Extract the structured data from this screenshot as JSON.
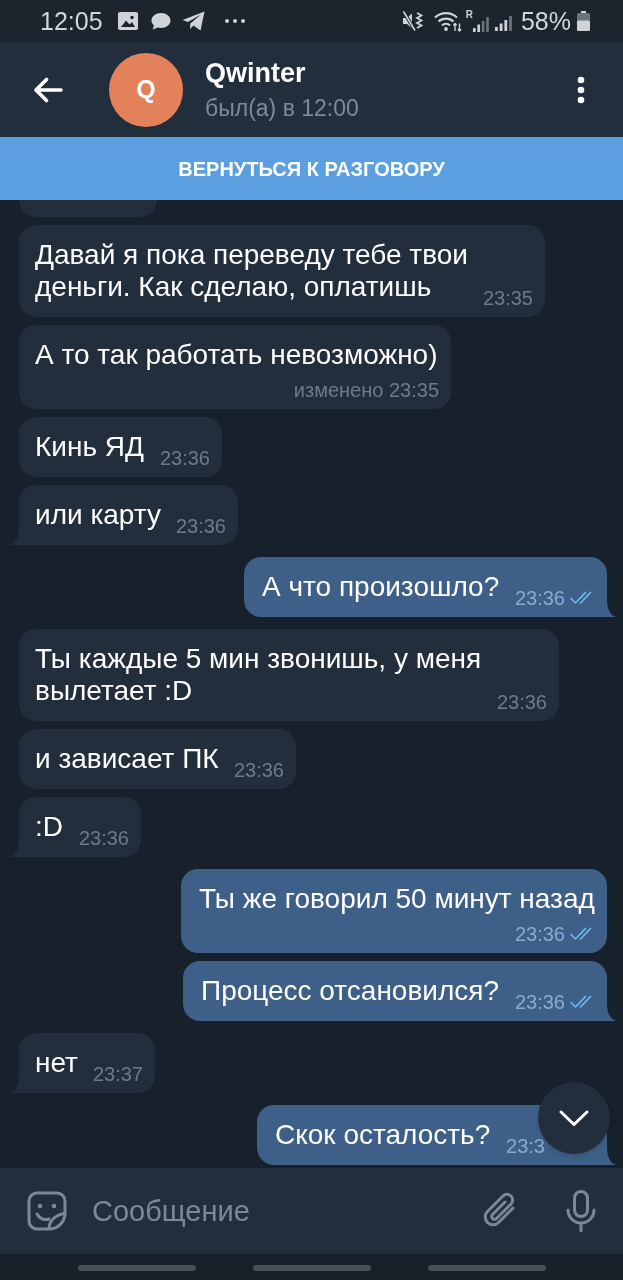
{
  "status_bar": {
    "time": "12:05",
    "roaming_label": "R",
    "battery_percent": "58%"
  },
  "header": {
    "avatar_letter": "Q",
    "name": "Qwinter",
    "last_seen": "был(а) в 12:00"
  },
  "call_banner": {
    "label": "ВЕРНУТЬСЯ К РАЗГОВОРУ"
  },
  "chat": {
    "partial_top_message": {
      "kind": "incoming"
    },
    "messages": [
      {
        "kind": "incoming",
        "text": "Давай я пока переведу тебе твои деньги. Как сделаю, оплатишь",
        "time": "23:35",
        "tail": false
      },
      {
        "kind": "incoming",
        "text": "А то так работать невозможно)",
        "time": "изменено 23:35",
        "tail": false
      },
      {
        "kind": "incoming",
        "text": "Кинь ЯД",
        "time": "23:36",
        "tail": false
      },
      {
        "kind": "incoming",
        "text": "или карту",
        "time": "23:36",
        "tail": true
      },
      {
        "kind": "outgoing",
        "text": "А что произошло?",
        "time": "23:36",
        "read": true,
        "tail": true
      },
      {
        "kind": "incoming",
        "text": "Ты каждые 5 мин звонишь, у меня вылетает :D",
        "time": "23:36",
        "tail": false
      },
      {
        "kind": "incoming",
        "text": "и зависает ПК",
        "time": "23:36",
        "tail": false
      },
      {
        "kind": "incoming",
        "text": ":D",
        "time": "23:36",
        "tail": true
      },
      {
        "kind": "outgoing",
        "text": "Ты же говорил 50 минут назад",
        "time": "23:36",
        "read": true,
        "tail": false
      },
      {
        "kind": "outgoing",
        "text": "Процесс отсановился?",
        "time": "23:36",
        "read": true,
        "tail": true
      },
      {
        "kind": "incoming",
        "text": "нет",
        "time": "23:37",
        "tail": true
      },
      {
        "kind": "outgoing",
        "text": "Скок осталость?",
        "time": "23:3",
        "tail": true
      }
    ]
  },
  "composer": {
    "placeholder": "Сообщение"
  }
}
